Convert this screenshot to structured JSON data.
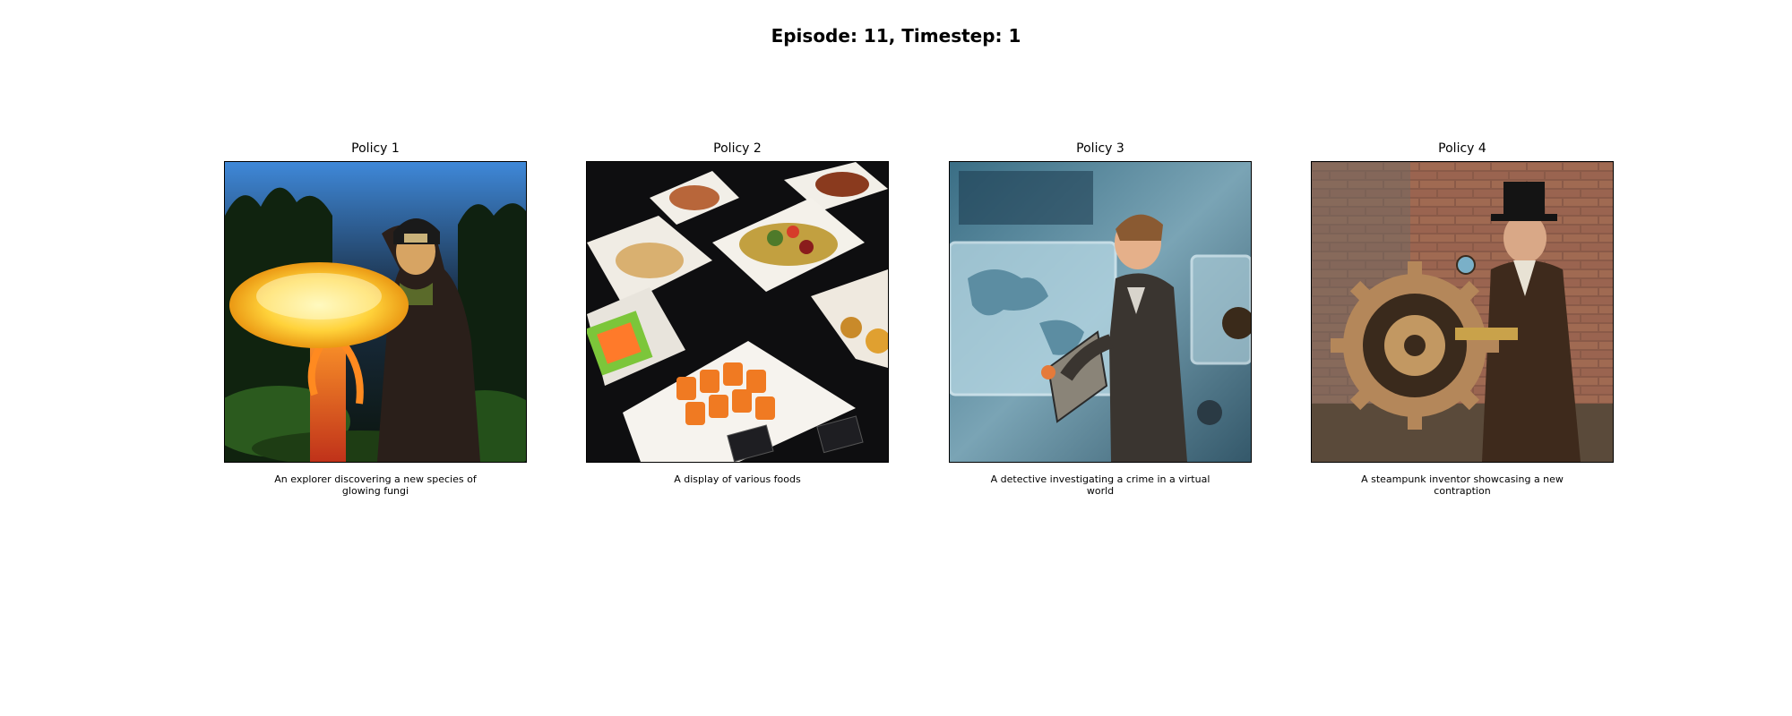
{
  "figure": {
    "title": "Episode: 11, Timestep: 1"
  },
  "panels": [
    {
      "title": "Policy 1",
      "caption": "An explorer discovering a new species of glowing fungi",
      "image_subject": "glowing-mushroom-explorer"
    },
    {
      "title": "Policy 2",
      "caption": "A display of various foods",
      "image_subject": "food-platters"
    },
    {
      "title": "Policy 3",
      "caption": "A detective investigating a crime in a virtual world",
      "image_subject": "detective-virtual-world"
    },
    {
      "title": "Policy 4",
      "caption": "A steampunk inventor showcasing a new contraption",
      "image_subject": "steampunk-inventor-gear"
    }
  ]
}
